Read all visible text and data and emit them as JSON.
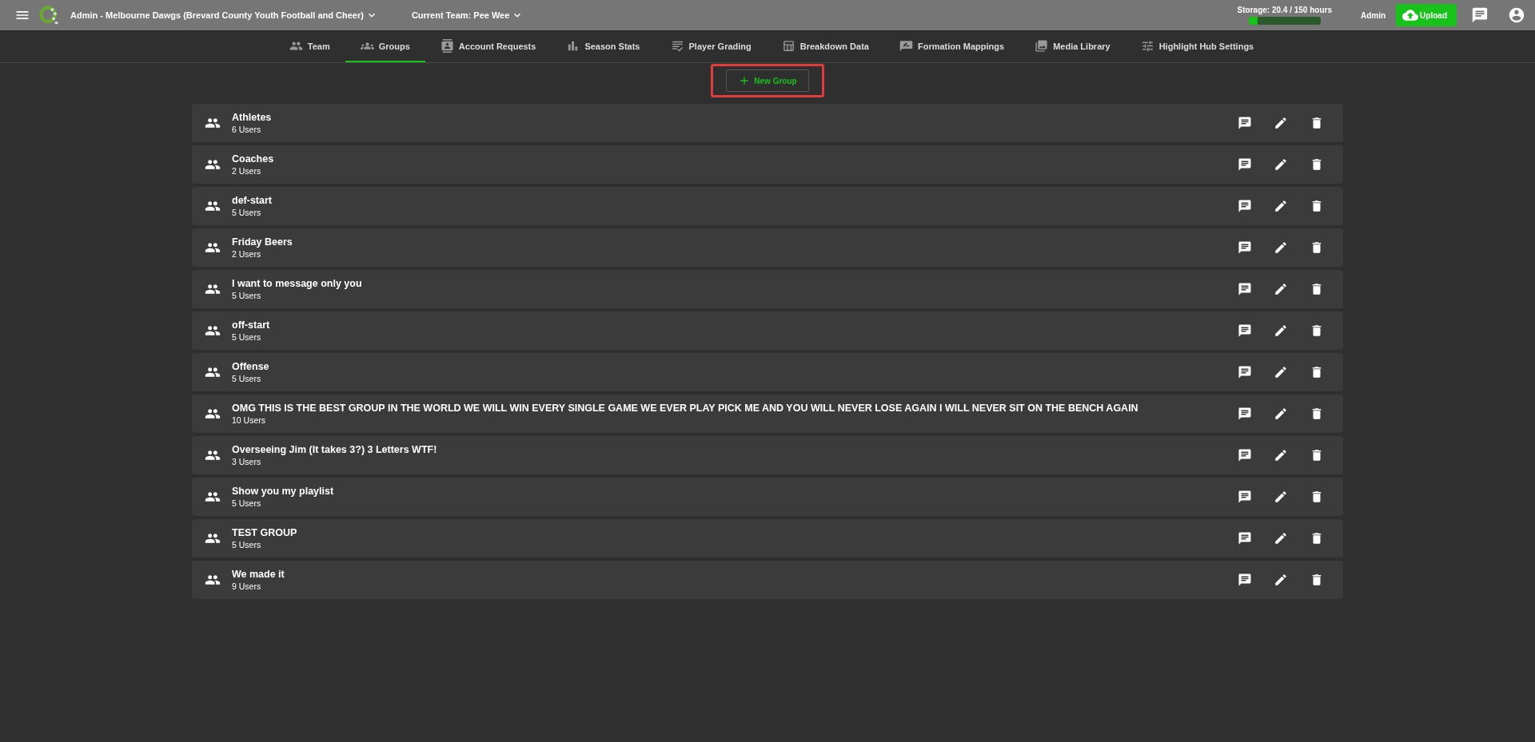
{
  "header": {
    "org": "Admin - Melbourne Dawgs (Brevard County Youth Football and Cheer)",
    "team": "Current Team: Pee Wee",
    "storage": {
      "label": "Storage: 20.4 / 150 hours",
      "level": 0.13
    },
    "role": "Admin",
    "upload": "Upload"
  },
  "tabs": [
    {
      "label": "Team",
      "selected": false
    },
    {
      "label": "Groups",
      "selected": true
    },
    {
      "label": "Account Requests",
      "selected": false
    },
    {
      "label": "Season Stats",
      "selected": false
    },
    {
      "label": "Player Grading",
      "selected": false
    },
    {
      "label": "Breakdown Data",
      "selected": false
    },
    {
      "label": "Formation Mappings",
      "selected": false
    },
    {
      "label": "Media Library",
      "selected": false
    },
    {
      "label": "Highlight Hub Settings",
      "selected": false
    }
  ],
  "new_group": {
    "label": "New Group",
    "highlighted": true
  },
  "groups": [
    {
      "name": "Athletes",
      "count": "6 Users"
    },
    {
      "name": "Coaches",
      "count": "2 Users"
    },
    {
      "name": "def-start",
      "count": "5 Users"
    },
    {
      "name": "Friday Beers",
      "count": "2 Users"
    },
    {
      "name": "I want to message only you",
      "count": "5 Users"
    },
    {
      "name": "off-start",
      "count": "5 Users"
    },
    {
      "name": "Offense",
      "count": "5 Users"
    },
    {
      "name": "OMG THIS IS THE BEST GROUP IN THE WORLD WE WILL WIN EVERY SINGLE GAME WE EVER PLAY PICK ME AND YOU WILL NEVER LOSE AGAIN I WILL NEVER SIT ON THE BENCH AGAIN",
      "count": "10 Users"
    },
    {
      "name": "Overseeing Jim (It takes 3?) 3 Letters WTF!",
      "count": "3 Users"
    },
    {
      "name": "Show you my playlist",
      "count": "5 Users"
    },
    {
      "name": "TEST GROUP",
      "count": "5 Users"
    },
    {
      "name": "We made it",
      "count": "9 Users"
    }
  ]
}
